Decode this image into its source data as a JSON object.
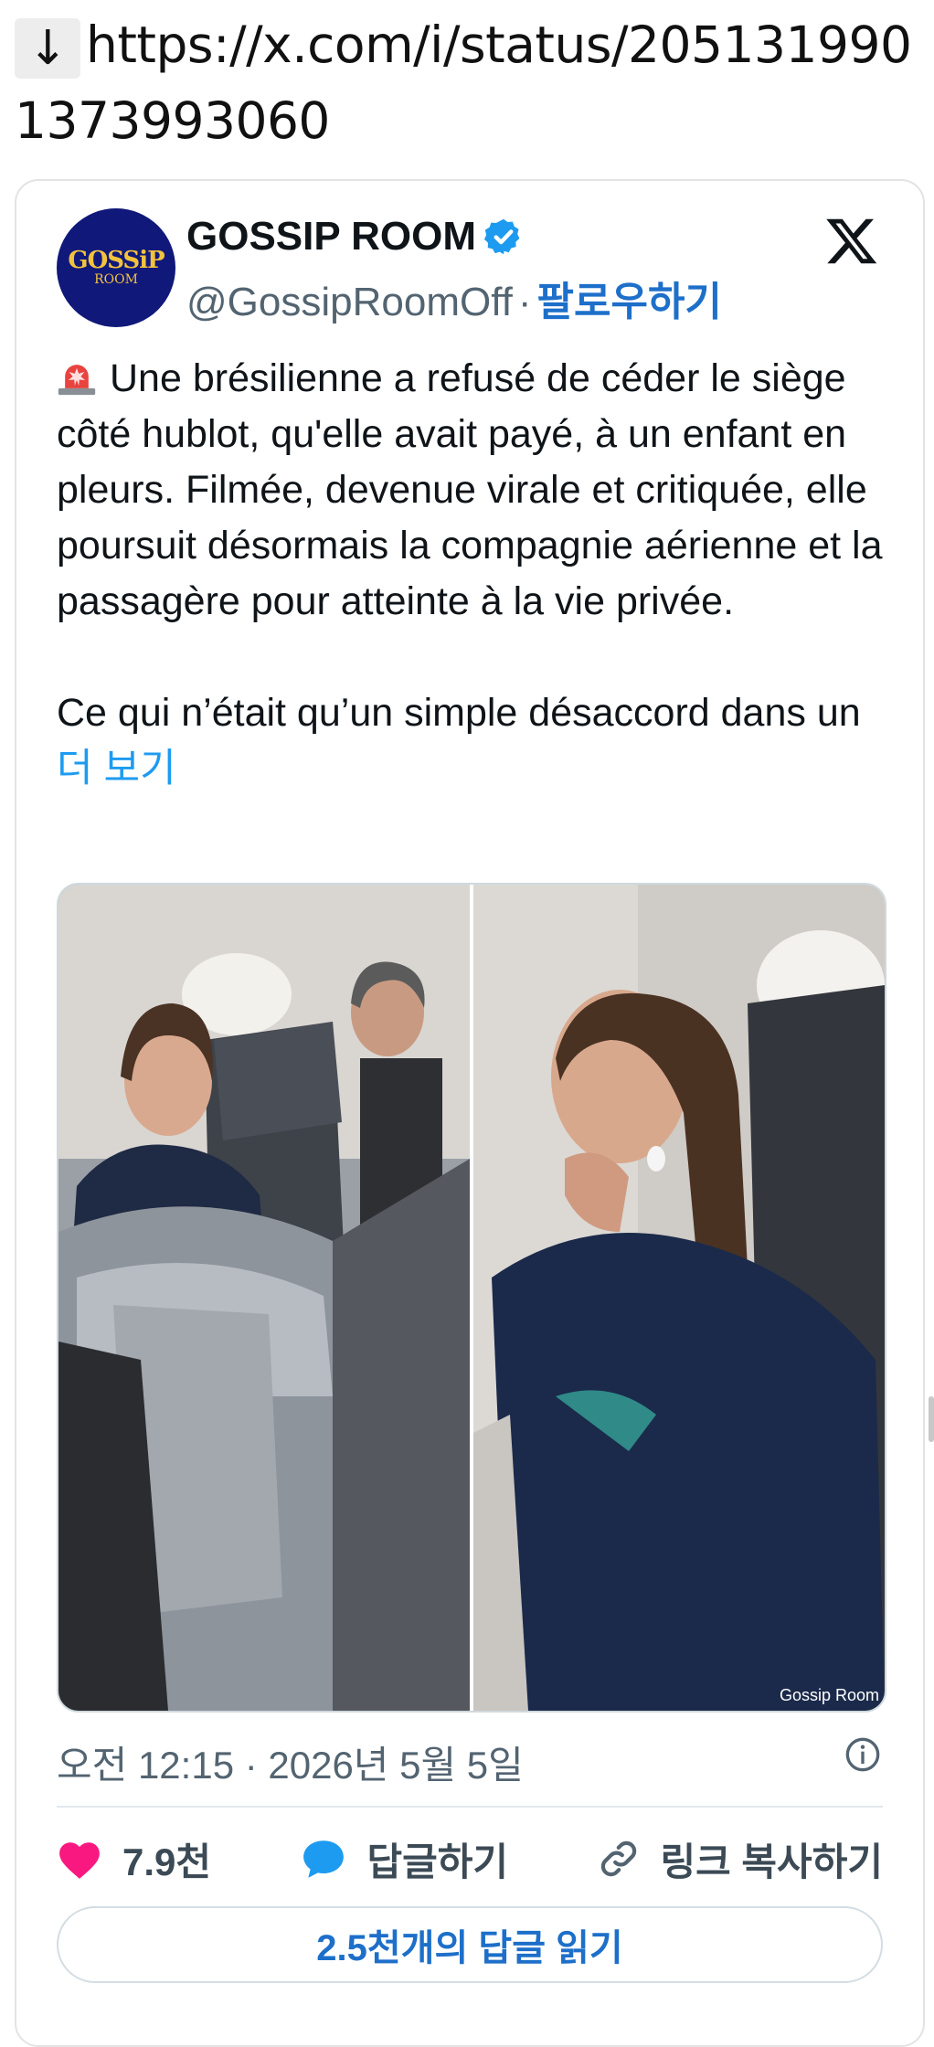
{
  "link": {
    "arrow_glyph": "↓",
    "url": "https://x.com/i/status/2051319901373993060"
  },
  "tweet": {
    "avatar_text_top": "GOSSiP",
    "avatar_text_bottom": "ROOM",
    "display_name": "GOSSIP ROOM",
    "handle": "@GossipRoomOff",
    "handle_separator": "·",
    "follow_label": "팔로우하기",
    "paragraph_1": "Une brésilienne a refusé de céder le siège côté hublot, qu'elle avait payé, à un enfant en pleurs. Filmée, devenue virale et critiquée, elle poursuit désormais la compagnie aérienne et la passagère pour atteinte à la vie privée.",
    "paragraph_2": "Ce qui n’était qu’un simple désaccord dans un",
    "more_label": "더 보기",
    "media_watermark": "Gossip Room",
    "timestamp": "오전 12:15 · 2026년 5월 5일",
    "likes": "7.9천",
    "reply_label": "답글하기",
    "copy_link_label": "링크 복사하기",
    "read_replies_label": "2.5천개의 답글 읽기"
  },
  "colors": {
    "accent": "#1d9bf0",
    "follow": "#1d6fc9",
    "heart": "#f91880",
    "avatar_bg": "#10187a"
  },
  "icons": [
    "down-arrow-icon",
    "verified-badge-icon",
    "x-logo-icon",
    "siren-emoji-icon",
    "info-icon",
    "heart-icon",
    "reply-bubble-icon",
    "link-icon"
  ]
}
